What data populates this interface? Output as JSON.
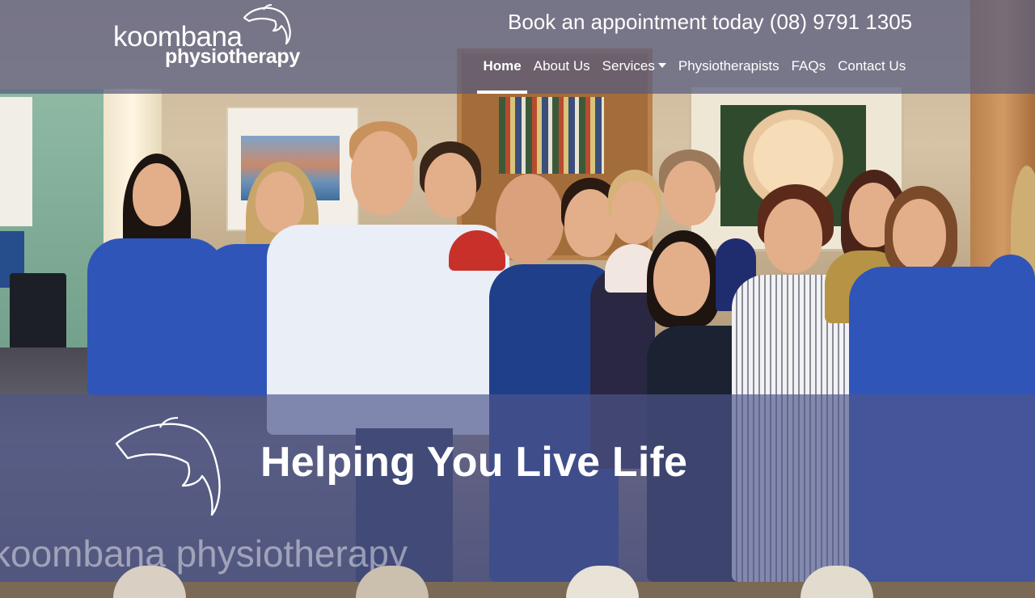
{
  "brand": {
    "logo_line1": "koombana",
    "logo_line2": "physiotherapy"
  },
  "header": {
    "cta_text": "Book an appointment today (08) 9791 1305"
  },
  "nav": {
    "items": [
      {
        "label": "Home",
        "active": true
      },
      {
        "label": "About Us",
        "active": false
      },
      {
        "label": "Services",
        "active": false,
        "dropdown": true
      },
      {
        "label": "Physiotherapists",
        "active": false
      },
      {
        "label": "FAQs",
        "active": false
      },
      {
        "label": "Contact Us",
        "active": false
      }
    ]
  },
  "hero": {
    "title": "Helping You Live Life",
    "photo_alt": "Team photo",
    "desk_brand": "koombana physiotherapy"
  },
  "icons": {
    "logo": "dolphin-icon",
    "dropdown": "caret-down-icon"
  },
  "colors": {
    "header_overlay": "#565C80",
    "hero_overlay": "#4E568A",
    "text": "#FFFFFF"
  }
}
